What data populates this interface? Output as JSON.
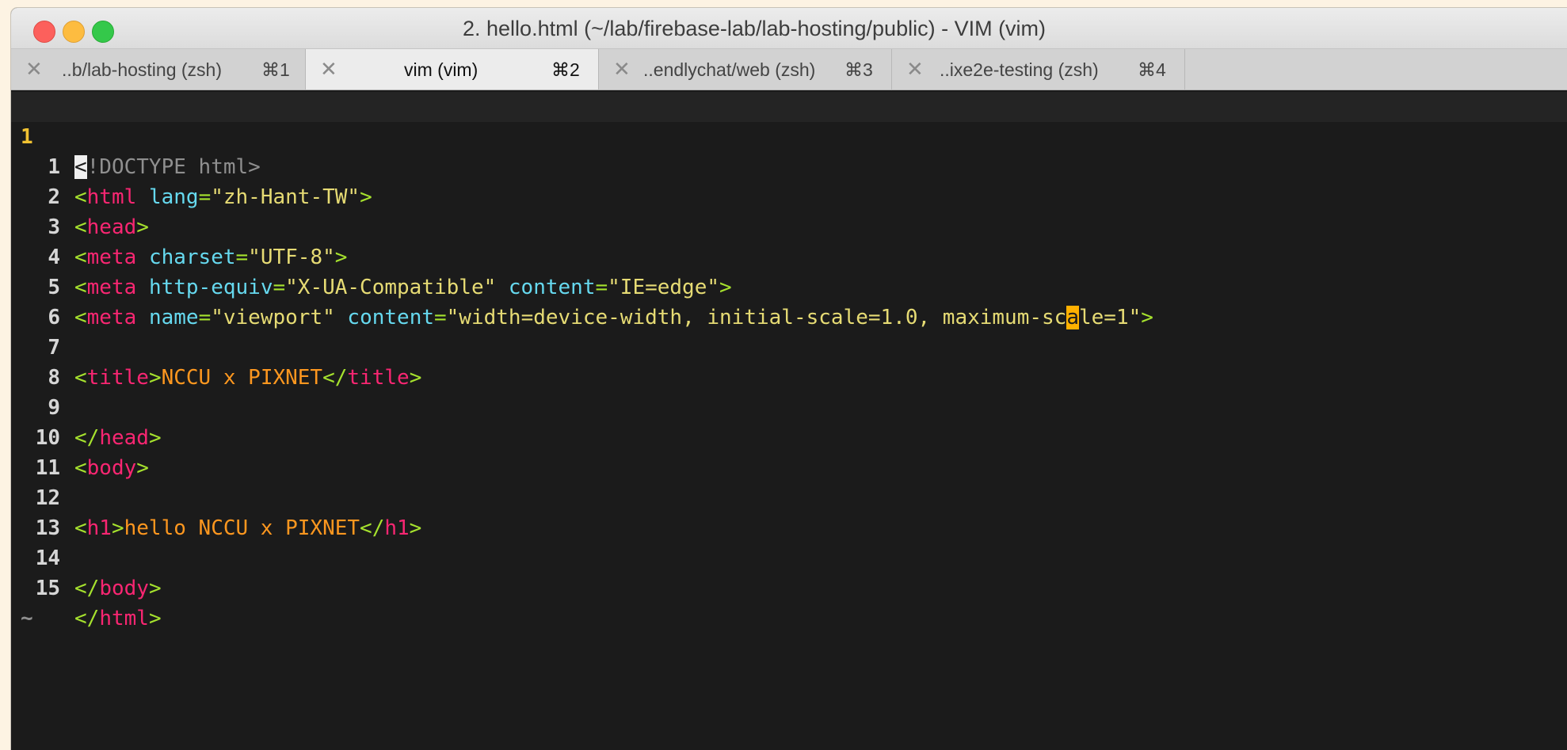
{
  "window": {
    "title": "2. hello.html (~/lab/firebase-lab/lab-hosting/public) - VIM (vim)"
  },
  "tabs": [
    {
      "label": "..b/lab-hosting (zsh)",
      "shortcut": "⌘1",
      "close": "✕"
    },
    {
      "label": "vim (vim)",
      "shortcut": "⌘2",
      "close": "✕"
    },
    {
      "label": "..endlychat/web (zsh)",
      "shortcut": "⌘3",
      "close": "✕"
    },
    {
      "label": "..ixe2e-testing (zsh)",
      "shortcut": "⌘4",
      "close": "✕"
    }
  ],
  "editor": {
    "current_line_number": "1",
    "lines": [
      {
        "ln": "1",
        "text": "<!DOCTYPE html>"
      },
      {
        "ln": "1",
        "text": "<html lang=\"zh-Hant-TW\">"
      },
      {
        "ln": "2",
        "text": "<head>"
      },
      {
        "ln": "3",
        "text": "<meta charset=\"UTF-8\">"
      },
      {
        "ln": "4",
        "text": "<meta http-equiv=\"X-UA-Compatible\" content=\"IE=edge\">"
      },
      {
        "ln": "5",
        "text": "<meta name=\"viewport\" content=\"width=device-width, initial-scale=1.0, maximum-scale=1\">"
      },
      {
        "ln": "6",
        "text": ""
      },
      {
        "ln": "7",
        "text": "<title>NCCU x PIXNET</title>"
      },
      {
        "ln": "8",
        "text": ""
      },
      {
        "ln": "9",
        "text": "</head>"
      },
      {
        "ln": "10",
        "text": "<body>"
      },
      {
        "ln": "11",
        "text": ""
      },
      {
        "ln": "12",
        "text": "<h1>hello NCCU x PIXNET</h1>"
      },
      {
        "ln": "13",
        "text": ""
      },
      {
        "ln": "14",
        "text": "</body>"
      },
      {
        "ln": "15",
        "text": "</html>"
      }
    ],
    "empty_line_marker": "~"
  },
  "colors": {
    "tag": "#f92672",
    "bracket": "#a6e22e",
    "attribute": "#66d9ef",
    "string": "#e6db74",
    "text": "#fd971f",
    "cursor": "#ffb000"
  }
}
